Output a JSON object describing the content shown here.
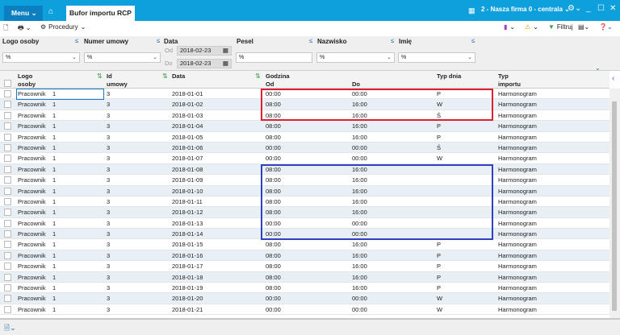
{
  "titlebar": {
    "menu": "Menu",
    "tab": "Bufor importu RCP",
    "company": "2 - Nasza firma 0 - centrala"
  },
  "toolbar": {
    "procedures": "Procedury",
    "filter": "Filtruj"
  },
  "filters": {
    "logo": {
      "label": "Logo osoby",
      "value": "%"
    },
    "contract": {
      "label": "Numer umowy",
      "value": "%"
    },
    "date": {
      "label": "Data",
      "from_label": "Od",
      "from": "2018-02-23",
      "to_label": "Do",
      "to": "2018-02-23"
    },
    "pesel": {
      "label": "Pesel",
      "value": "%"
    },
    "surname": {
      "label": "Nazwisko",
      "value": "%"
    },
    "name": {
      "label": "Imię",
      "value": "%"
    }
  },
  "columns": {
    "logo": "Logo",
    "logo2": "osoby",
    "id": "Id",
    "id2": "umowy",
    "date": "Data",
    "hour": "Godzina",
    "from": "Od",
    "to": "Do",
    "daytype": "Typ dnia",
    "importtype": "Typ",
    "importtype2": "importu"
  },
  "rows": [
    [
      "Pracownik",
      "1",
      "3",
      "2018-01-01",
      "00:00",
      "00:00",
      "P",
      "Harmonogram"
    ],
    [
      "Pracownik",
      "1",
      "3",
      "2018-01-02",
      "08:00",
      "16:00",
      "W",
      "Harmonogram"
    ],
    [
      "Pracownik",
      "1",
      "3",
      "2018-01-03",
      "08:00",
      "16:00",
      "Ś",
      "Harmonogram"
    ],
    [
      "Pracownik",
      "1",
      "3",
      "2018-01-04",
      "08:00",
      "16:00",
      "P",
      "Harmonogram"
    ],
    [
      "Pracownik",
      "1",
      "3",
      "2018-01-05",
      "08:00",
      "16:00",
      "P",
      "Harmonogram"
    ],
    [
      "Pracownik",
      "1",
      "3",
      "2018-01-06",
      "00:00",
      "00:00",
      "Ś",
      "Harmonogram"
    ],
    [
      "Pracownik",
      "1",
      "3",
      "2018-01-07",
      "00:00",
      "00:00",
      "W",
      "Harmonogram"
    ],
    [
      "Pracownik",
      "1",
      "3",
      "2018-01-08",
      "08:00",
      "16:00",
      "",
      "Harmonogram"
    ],
    [
      "Pracownik",
      "1",
      "3",
      "2018-01-09",
      "08:00",
      "16:00",
      "",
      "Harmonogram"
    ],
    [
      "Pracownik",
      "1",
      "3",
      "2018-01-10",
      "08:00",
      "16:00",
      "",
      "Harmonogram"
    ],
    [
      "Pracownik",
      "1",
      "3",
      "2018-01-11",
      "08:00",
      "16:00",
      "",
      "Harmonogram"
    ],
    [
      "Pracownik",
      "1",
      "3",
      "2018-01-12",
      "08:00",
      "16:00",
      "",
      "Harmonogram"
    ],
    [
      "Pracownik",
      "1",
      "3",
      "2018-01-13",
      "00:00",
      "00:00",
      "",
      "Harmonogram"
    ],
    [
      "Pracownik",
      "1",
      "3",
      "2018-01-14",
      "00:00",
      "00:00",
      "",
      "Harmonogram"
    ],
    [
      "Pracownik",
      "1",
      "3",
      "2018-01-15",
      "08:00",
      "16:00",
      "P",
      "Harmonogram"
    ],
    [
      "Pracownik",
      "1",
      "3",
      "2018-01-16",
      "08:00",
      "16:00",
      "P",
      "Harmonogram"
    ],
    [
      "Pracownik",
      "1",
      "3",
      "2018-01-17",
      "08:00",
      "16:00",
      "P",
      "Harmonogram"
    ],
    [
      "Pracownik",
      "1",
      "3",
      "2018-01-18",
      "08:00",
      "16:00",
      "P",
      "Harmonogram"
    ],
    [
      "Pracownik",
      "1",
      "3",
      "2018-01-19",
      "08:00",
      "16:00",
      "P",
      "Harmonogram"
    ],
    [
      "Pracownik",
      "1",
      "3",
      "2018-01-20",
      "00:00",
      "00:00",
      "W",
      "Harmonogram"
    ],
    [
      "Pracownik",
      "1",
      "3",
      "2018-01-21",
      "00:00",
      "00:00",
      "W",
      "Harmonogram"
    ]
  ],
  "colors": {
    "accent": "#0ea0dc",
    "highlight_red": "#e02030",
    "highlight_blue": "#3040c0"
  }
}
